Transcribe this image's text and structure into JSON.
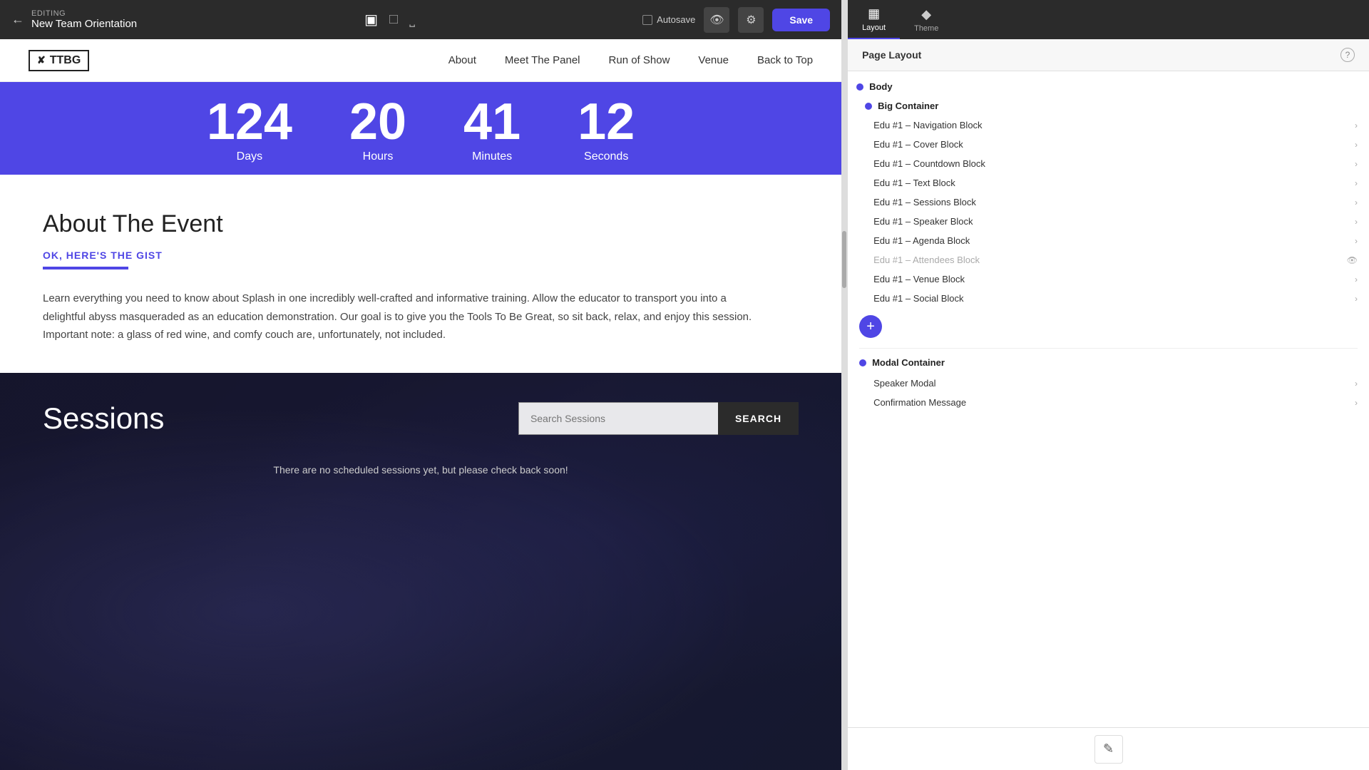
{
  "topbar": {
    "editing_label": "EDITING",
    "project_name": "New Team Orientation",
    "autosave_label": "Autosave",
    "save_label": "Save"
  },
  "nav": {
    "logo_text": "TTBG",
    "links": [
      "About",
      "Meet The Panel",
      "Run of Show",
      "Venue",
      "Back to Top"
    ]
  },
  "countdown": {
    "items": [
      {
        "number": "124",
        "label": "Days"
      },
      {
        "number": "20",
        "label": "Hours"
      },
      {
        "number": "41",
        "label": "Minutes"
      },
      {
        "number": "12",
        "label": "Seconds"
      }
    ]
  },
  "about": {
    "title": "About The Event",
    "subtitle": "OK, HERE'S THE GIST",
    "body": "Learn everything you need to know about Splash in one incredibly well-crafted and informative training. Allow the educator to transport you into a delightful abyss masqueraded as an education demonstration. Our goal is to give you the Tools To Be Great, so sit back, relax, and enjoy this session. Important note: a glass of red wine, and comfy couch are, unfortunately, not included."
  },
  "sessions": {
    "title": "Sessions",
    "search_placeholder": "Search Sessions",
    "search_button": "SEARCH",
    "empty_message": "There are no scheduled sessions yet, but please check back soon!"
  },
  "right_panel": {
    "tabs": [
      {
        "label": "Layout",
        "active": true
      },
      {
        "label": "Theme",
        "active": false
      }
    ],
    "page_layout_title": "Page Layout",
    "tree": {
      "body_label": "Body",
      "big_container_label": "Big Container",
      "blocks": [
        {
          "label": "Edu #1 – Navigation Block"
        },
        {
          "label": "Edu #1 – Cover Block"
        },
        {
          "label": "Edu #1 – Countdown Block"
        },
        {
          "label": "Edu #1 – Text Block"
        },
        {
          "label": "Edu #1 – Sessions Block"
        },
        {
          "label": "Edu #1 – Speaker Block"
        },
        {
          "label": "Edu #1 – Agenda Block"
        },
        {
          "label": "Edu #1 – Attendees Block",
          "highlighted": true
        },
        {
          "label": "Edu #1 – Venue Block"
        },
        {
          "label": "Edu #1 – Social Block"
        }
      ],
      "modal_container_label": "Modal Container",
      "modals": [
        {
          "label": "Speaker Modal"
        },
        {
          "label": "Confirmation Message"
        }
      ]
    }
  }
}
